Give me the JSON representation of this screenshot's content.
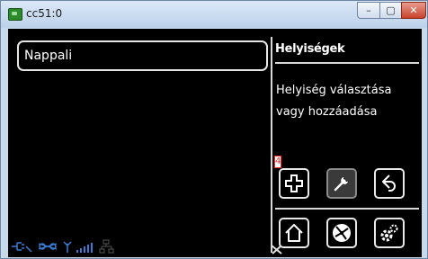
{
  "window": {
    "title": "cc51:0",
    "minimize": "–",
    "maximize": "▢",
    "close": "✕"
  },
  "list": {
    "items": [
      "Nappali"
    ]
  },
  "panel": {
    "title": "Helyiségek",
    "description_line1": "Helyiség választása",
    "description_line2": "vagy hozzáadása"
  },
  "marker": "4",
  "buttons": {
    "row1": [
      "plus-icon",
      "wrench-icon",
      "back-icon"
    ],
    "row2": [
      "home-icon",
      "fan-icon",
      "gears-icon"
    ]
  },
  "colors": {
    "accent": "#2a7fff",
    "background": "#000000",
    "foreground": "#ffffff"
  }
}
